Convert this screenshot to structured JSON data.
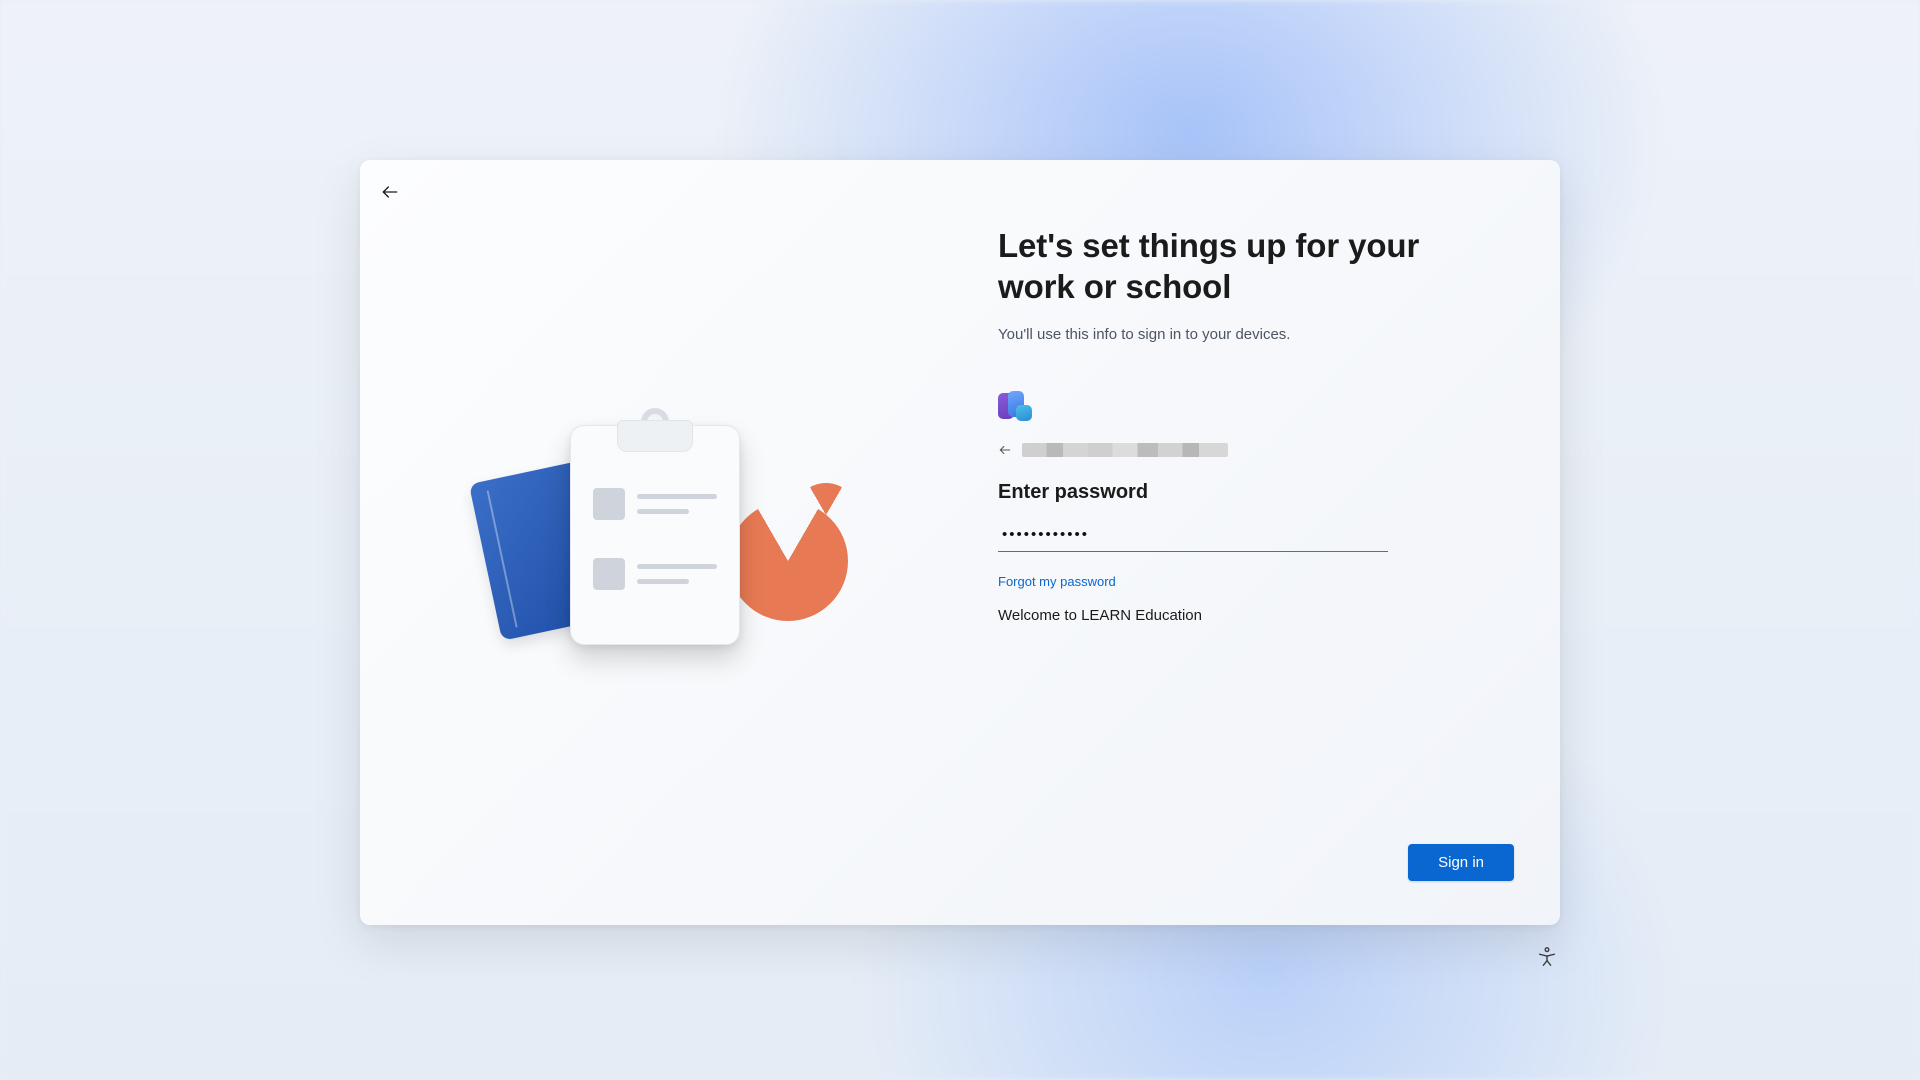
{
  "title": "Let's set things up for your work or school",
  "subtitle": "You'll use this info to sign in to your devices.",
  "section_label": "Enter password",
  "password_value": "••••••••••••",
  "forgot_link": "Forgot my password",
  "welcome_text": "Welcome to LEARN Education",
  "signin_label": "Sign in"
}
